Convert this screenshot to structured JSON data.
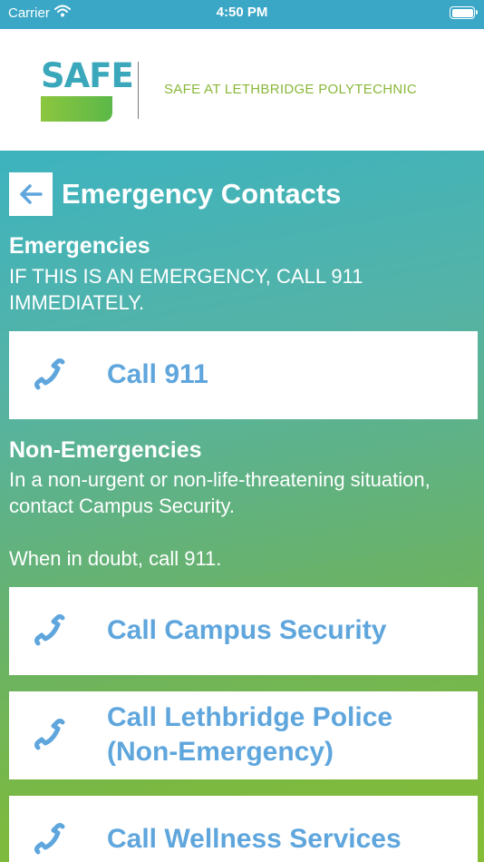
{
  "status_bar": {
    "carrier": "Carrier",
    "time": "4:50 PM"
  },
  "header": {
    "logo_text": "SAFE",
    "tagline_prefix": "SAFE AT ",
    "tagline_suffix": "LETHBRIDGE POLYTECHNIC"
  },
  "page": {
    "title": "Emergency Contacts"
  },
  "emergencies": {
    "heading": "Emergencies",
    "text": "IF THIS IS AN EMERGENCY, CALL 911 IMMEDIATELY."
  },
  "non_emergencies": {
    "heading": "Non-Emergencies",
    "text": "In a non-urgent or non-life-threatening situation, contact Campus Security.",
    "note": "When in doubt, call 911."
  },
  "calls": {
    "call_911": "Call 911",
    "campus_security": "Call Campus Security",
    "police_line1": "Call Lethbridge Police",
    "police_line2": "(Non-Emergency)",
    "wellness": "Call Wellness Services"
  },
  "colors": {
    "accent_blue": "#5fa6dd",
    "brand_teal": "#3aa7bb",
    "brand_green": "#8cc63f"
  },
  "icons": {
    "back": "arrow-left-icon",
    "phone": "phone-icon",
    "wifi": "wifi-icon",
    "battery": "battery-icon"
  }
}
